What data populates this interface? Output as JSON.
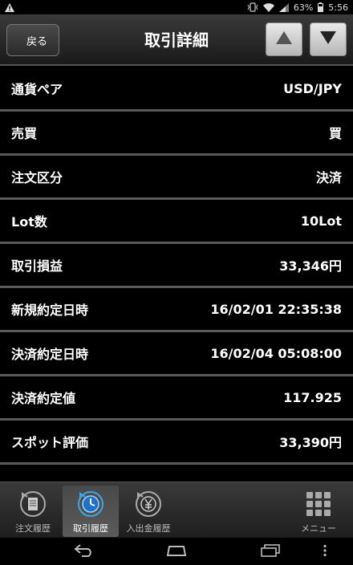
{
  "statusbar": {
    "battery": "63%",
    "time": "5:56",
    "icons": [
      "warning-icon",
      "vibrate-icon",
      "wifi-icon",
      "signal-icon",
      "battery-icon"
    ]
  },
  "header": {
    "back_label": "戻る",
    "title": "取引詳細",
    "prev_icon": "triangle-up-icon",
    "next_icon": "triangle-down-icon"
  },
  "rows": [
    {
      "label": "通貨ペア",
      "value": "USD/JPY"
    },
    {
      "label": "売買",
      "value": "買"
    },
    {
      "label": "注文区分",
      "value": "決済"
    },
    {
      "label": "Lot数",
      "value": "10Lot"
    },
    {
      "label": "取引損益",
      "value": "33,346円"
    },
    {
      "label": "新規約定日時",
      "value": "16/02/01 22:35:38"
    },
    {
      "label": "決済約定日時",
      "value": "16/02/04 05:08:00"
    },
    {
      "label": "決済約定値",
      "value": "117.925"
    },
    {
      "label": "スポット評価",
      "value": "33,390円"
    }
  ],
  "tabs": [
    {
      "label": "注文履歴",
      "icon": "order-history-icon"
    },
    {
      "label": "取引履歴",
      "icon": "trade-history-icon",
      "active": true
    },
    {
      "label": "入出金履歴",
      "icon": "deposit-history-icon"
    },
    {
      "label": "メニュー",
      "icon": "menu-grid-icon"
    }
  ],
  "navbar": {
    "icons": [
      "back-icon",
      "home-icon",
      "recents-icon",
      "overflow-icon"
    ]
  }
}
